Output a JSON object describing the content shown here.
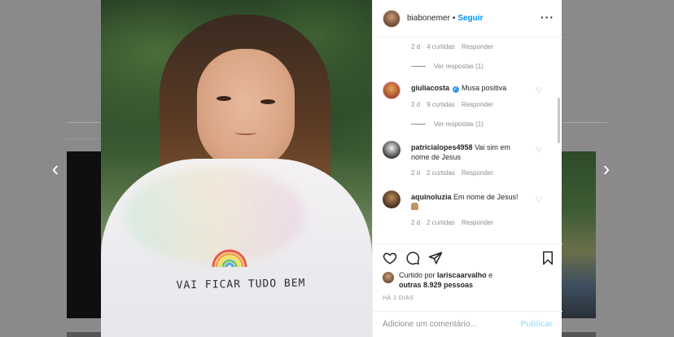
{
  "header": {
    "username": "biabonemer",
    "separator": "•",
    "follow_label": "Seguir",
    "more_label": "···"
  },
  "comments": {
    "first_meta": {
      "time": "2 d",
      "likes": "4 curtidas",
      "reply": "Responder"
    },
    "first_replies": "Ver respostas (1)",
    "items": [
      {
        "username": "giuliacosta",
        "verified": true,
        "text": "Musa positiva",
        "time": "2 d",
        "likes": "9 curtidas",
        "reply": "Responder",
        "replies": "Ver respostas (1)"
      },
      {
        "username": "patricialopes4958",
        "verified": false,
        "text": "Vai sim em nome de Jesus",
        "time": "2 d",
        "likes": "2 curtidas",
        "reply": "Responder"
      },
      {
        "username": "aquinoluzia",
        "verified": false,
        "text": "Em nome de Jesus!",
        "emoji": "folded-hands",
        "time": "2 d",
        "likes": "2 curtidas",
        "reply": "Responder"
      }
    ]
  },
  "actions": {
    "icons": [
      "heart-icon",
      "comment-icon",
      "share-icon",
      "bookmark-icon"
    ]
  },
  "likes": {
    "prefix": "Curtido por",
    "user": "lariscaarvalho",
    "conjunction": "e",
    "others": "outras 8.929 pessoas"
  },
  "date": "HÁ 2 DIAS",
  "comment_box": {
    "placeholder": "Adicione um comentário...",
    "post_label": "Publicar"
  },
  "photo": {
    "shirt_text": "VAI FICAR TUDO BEM"
  },
  "navigation": {
    "prev": "‹",
    "next": "›"
  },
  "colors": {
    "link_blue": "#0095f6",
    "post_disabled": "#b2dffc",
    "meta_gray": "#8e8e8e"
  }
}
